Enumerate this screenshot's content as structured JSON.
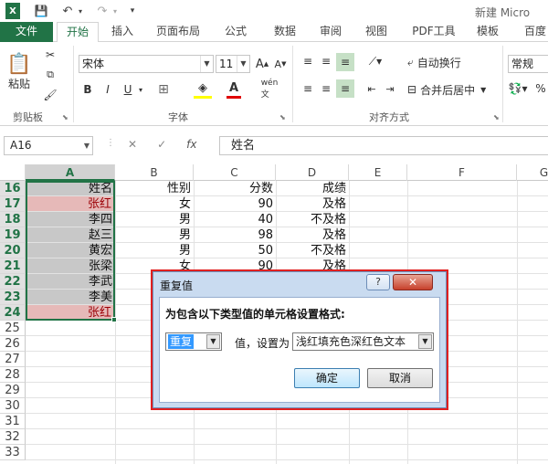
{
  "titlebar": {
    "app_title": "新建 Micro"
  },
  "tabs": [
    "文件",
    "开始",
    "插入",
    "页面布局",
    "公式",
    "数据",
    "审阅",
    "视图",
    "PDF工具",
    "模板",
    "百度"
  ],
  "ribbon": {
    "clipboard": {
      "paste_label": "粘贴",
      "group_label": "剪贴板"
    },
    "font": {
      "font_name": "宋体",
      "font_size": "11",
      "group_label": "字体",
      "bold": "B",
      "italic": "I",
      "underline": "U",
      "grow": "A",
      "shrink": "A"
    },
    "alignment": {
      "wrap_label": "自动换行",
      "merge_label": "合并后居中",
      "group_label": "对齐方式"
    },
    "number": {
      "format": "常规"
    }
  },
  "formula_bar": {
    "name_box": "A16",
    "cancel": "✕",
    "enter": "✓",
    "fx": "fx",
    "content": "姓名"
  },
  "columns": [
    "A",
    "B",
    "C",
    "D",
    "E",
    "F",
    "G"
  ],
  "rows": [
    "16",
    "17",
    "18",
    "19",
    "20",
    "21",
    "22",
    "23",
    "24",
    "25",
    "26",
    "27",
    "28",
    "29",
    "30",
    "31",
    "32",
    "33"
  ],
  "table": [
    {
      "name": "姓名",
      "gender": "性别",
      "score": "分数",
      "grade": "成绩"
    },
    {
      "name": "张红",
      "gender": "女",
      "score": "90",
      "grade": "及格",
      "dup": true
    },
    {
      "name": "李四",
      "gender": "男",
      "score": "40",
      "grade": "不及格"
    },
    {
      "name": "赵三",
      "gender": "男",
      "score": "98",
      "grade": "及格"
    },
    {
      "name": "黄宏",
      "gender": "男",
      "score": "50",
      "grade": "不及格"
    },
    {
      "name": "张梁",
      "gender": "女",
      "score": "90",
      "grade": "及格"
    },
    {
      "name": "李武",
      "gender": "",
      "score": "",
      "grade": ""
    },
    {
      "name": "李美",
      "gender": "",
      "score": "",
      "grade": ""
    },
    {
      "name": "张红",
      "gender": "",
      "score": "",
      "grade": "",
      "dup": true
    }
  ],
  "dialog": {
    "title": "重复值",
    "help": "?",
    "close": "✕",
    "prompt": "为包含以下类型值的单元格设置格式:",
    "type_value": "重复",
    "set_label": "值，设置为",
    "format_value": "浅红填充色深红色文本",
    "ok": "确定",
    "cancel": "取消"
  }
}
